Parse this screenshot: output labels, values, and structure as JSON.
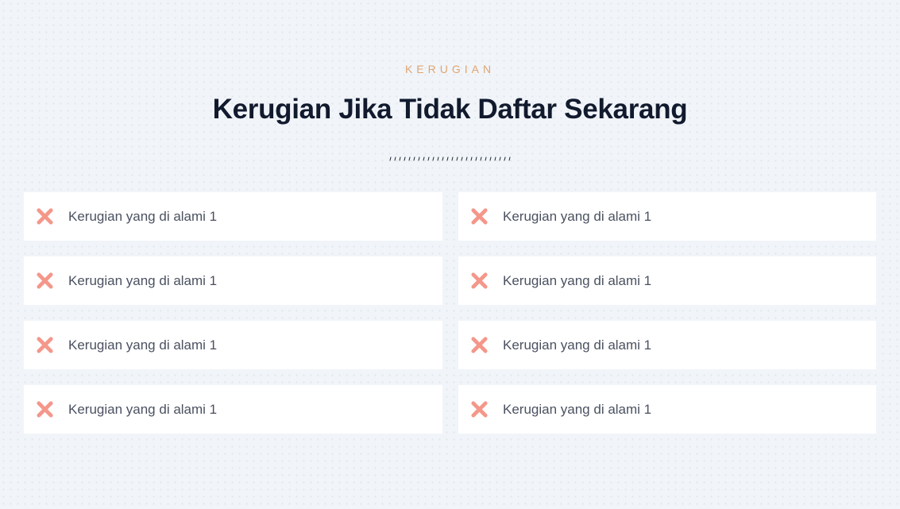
{
  "section": {
    "eyebrow": "KERUGIAN",
    "title": "Kerugian Jika Tidak Daftar Sekarang"
  },
  "items": [
    {
      "label": "Kerugian yang di alami 1",
      "icon": "x-mark-icon"
    },
    {
      "label": "Kerugian yang di alami 1",
      "icon": "x-mark-icon"
    },
    {
      "label": "Kerugian yang di alami 1",
      "icon": "x-mark-icon"
    },
    {
      "label": "Kerugian yang di alami 1",
      "icon": "x-mark-icon"
    },
    {
      "label": "Kerugian yang di alami 1",
      "icon": "x-mark-icon"
    },
    {
      "label": "Kerugian yang di alami 1",
      "icon": "x-mark-icon"
    },
    {
      "label": "Kerugian yang di alami 1",
      "icon": "x-mark-icon"
    },
    {
      "label": "Kerugian yang di alami 1",
      "icon": "x-mark-icon"
    }
  ],
  "colors": {
    "background": "#f1f5f9",
    "eyebrow": "#e0a572",
    "title": "#121a2e",
    "icon": "#f4978a",
    "card": "#ffffff",
    "text": "#4a5160"
  }
}
